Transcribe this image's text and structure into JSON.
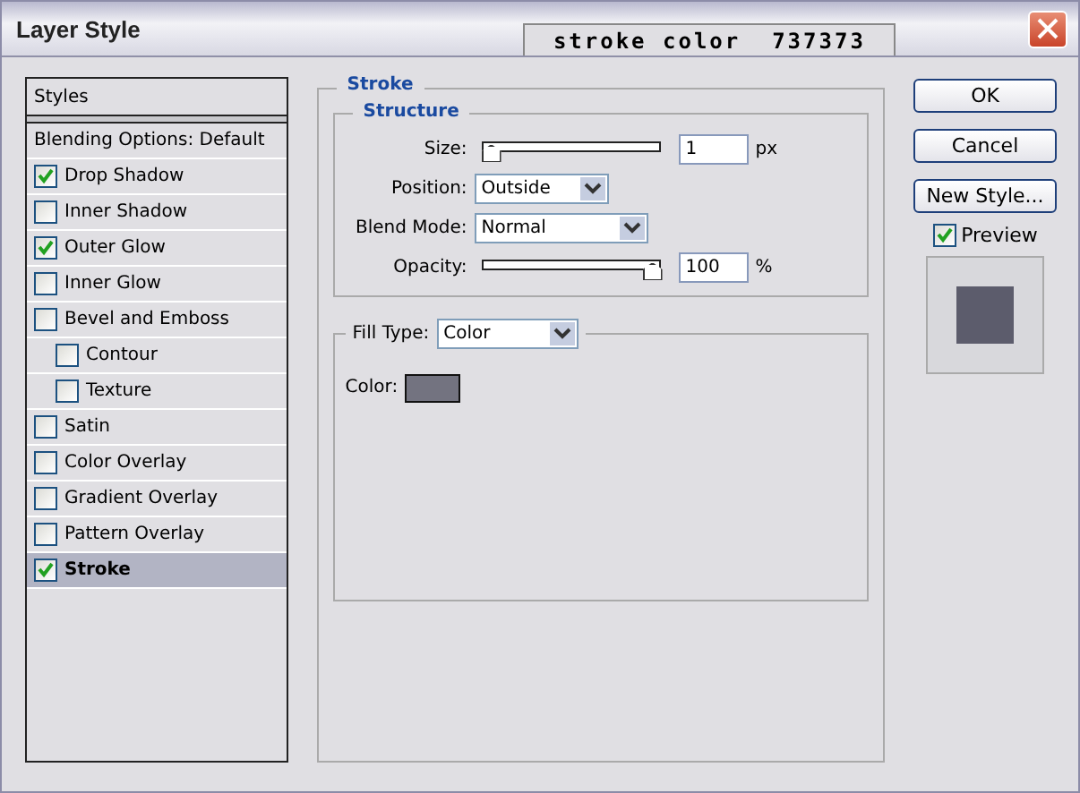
{
  "window": {
    "title": "Layer Style",
    "tab_label": "stroke color  737373"
  },
  "styles_panel": {
    "header": "Styles",
    "items": [
      {
        "label": "Blending Options: Default",
        "kind": "plain",
        "selected": false
      },
      {
        "label": "Drop Shadow",
        "kind": "checkbox",
        "checked": true,
        "selected": false
      },
      {
        "label": "Inner Shadow",
        "kind": "checkbox",
        "checked": false,
        "selected": false
      },
      {
        "label": "Outer Glow",
        "kind": "checkbox",
        "checked": true,
        "selected": false
      },
      {
        "label": "Inner Glow",
        "kind": "checkbox",
        "checked": false,
        "selected": false
      },
      {
        "label": "Bevel and Emboss",
        "kind": "checkbox",
        "checked": false,
        "selected": false,
        "children": [
          {
            "label": "Contour",
            "kind": "checkbox",
            "checked": false,
            "selected": false
          },
          {
            "label": "Texture",
            "kind": "checkbox",
            "checked": false,
            "selected": false
          }
        ]
      },
      {
        "label": "Satin",
        "kind": "checkbox",
        "checked": false,
        "selected": false
      },
      {
        "label": "Color Overlay",
        "kind": "checkbox",
        "checked": false,
        "selected": false
      },
      {
        "label": "Gradient Overlay",
        "kind": "checkbox",
        "checked": false,
        "selected": false
      },
      {
        "label": "Pattern Overlay",
        "kind": "checkbox",
        "checked": false,
        "selected": false
      },
      {
        "label": "Stroke",
        "kind": "checkbox",
        "checked": true,
        "selected": true
      }
    ]
  },
  "stroke": {
    "title": "Stroke",
    "structure": {
      "title": "Structure",
      "size": {
        "label": "Size:",
        "level": 0,
        "value": "1",
        "unit": "px"
      },
      "position": {
        "label": "Position:",
        "value": "Outside"
      },
      "blend_mode": {
        "label": "Blend Mode:",
        "value": "Normal"
      },
      "opacity": {
        "label": "Opacity:",
        "level": 1,
        "value": "100",
        "unit": "%"
      }
    },
    "fill": {
      "label": "Fill Type:",
      "value": "Color",
      "color_label": "Color:",
      "color": "#737380"
    }
  },
  "buttons": [
    "OK",
    "Cancel",
    "New Style..."
  ],
  "preview": {
    "label": "Preview",
    "checked": true
  }
}
